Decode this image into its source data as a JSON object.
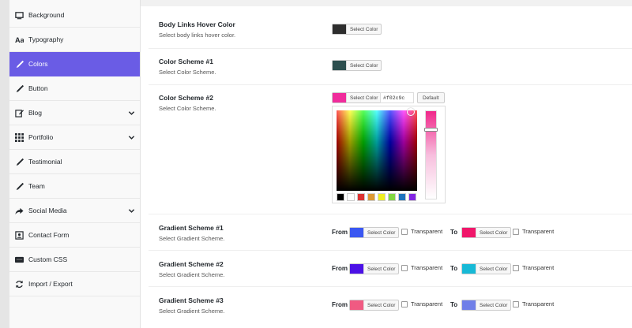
{
  "sidebar": {
    "items": [
      {
        "label": "Background",
        "icon": "monitor-icon",
        "chevron": false,
        "active": false
      },
      {
        "label": "Typography",
        "icon": "typography-icon",
        "chevron": false,
        "active": false
      },
      {
        "label": "Colors",
        "icon": "brush-icon",
        "chevron": false,
        "active": true
      },
      {
        "label": "Button",
        "icon": "brush-icon",
        "chevron": false,
        "active": false
      },
      {
        "label": "Blog",
        "icon": "edit-icon",
        "chevron": true,
        "active": false
      },
      {
        "label": "Portfolio",
        "icon": "grid-icon",
        "chevron": true,
        "active": false
      },
      {
        "label": "Testimonial",
        "icon": "brush-icon",
        "chevron": false,
        "active": false
      },
      {
        "label": "Team",
        "icon": "brush-icon",
        "chevron": false,
        "active": false
      },
      {
        "label": "Social Media",
        "icon": "share-icon",
        "chevron": true,
        "active": false
      },
      {
        "label": "Contact Form",
        "icon": "contact-card-icon",
        "chevron": false,
        "active": false
      },
      {
        "label": "Custom CSS",
        "icon": "css-icon",
        "chevron": false,
        "active": false
      },
      {
        "label": "Import / Export",
        "icon": "refresh-icon",
        "chevron": false,
        "active": false
      }
    ]
  },
  "options": {
    "body_links_hover": {
      "title": "Body Links Hover Color",
      "desc": "Select body links hover color.",
      "color": "#2e2e2e",
      "button": "Select Color"
    },
    "color_scheme_1": {
      "title": "Color Scheme #1",
      "desc": "Select Color Scheme.",
      "color": "#2d4f4f",
      "button": "Select Color"
    },
    "color_scheme_2": {
      "title": "Color Scheme #2",
      "desc": "Select Color Scheme.",
      "color": "#f02c9c",
      "button": "Select Color",
      "hex": "#f02c9c",
      "default_label": "Default"
    },
    "gradient_1": {
      "title": "Gradient Scheme #1",
      "desc": "Select Gradient Scheme.",
      "from_label": "From",
      "to_label": "To",
      "from_color": "#3a57f2",
      "to_color": "#f0166a",
      "button": "Select Color",
      "transparent_label": "Transparent"
    },
    "gradient_2": {
      "title": "Gradient Scheme #2",
      "desc": "Select Gradient Scheme.",
      "from_label": "From",
      "to_label": "To",
      "from_color": "#4b11e6",
      "to_color": "#17b9d6",
      "button": "Select Color",
      "transparent_label": "Transparent"
    },
    "gradient_3": {
      "title": "Gradient Scheme #3",
      "desc": "Select Gradient Scheme.",
      "from_label": "From",
      "to_label": "To",
      "from_color": "#f05a82",
      "to_color": "#6f7fe8",
      "button": "Select Color",
      "transparent_label": "Transparent"
    }
  },
  "picker": {
    "palette": [
      "#000000",
      "#ffffff",
      "#dd3333",
      "#dd9933",
      "#eeee22",
      "#81d742",
      "#1e73be",
      "#8224e3"
    ]
  },
  "colors": {
    "accent": "#6a5ce5"
  }
}
